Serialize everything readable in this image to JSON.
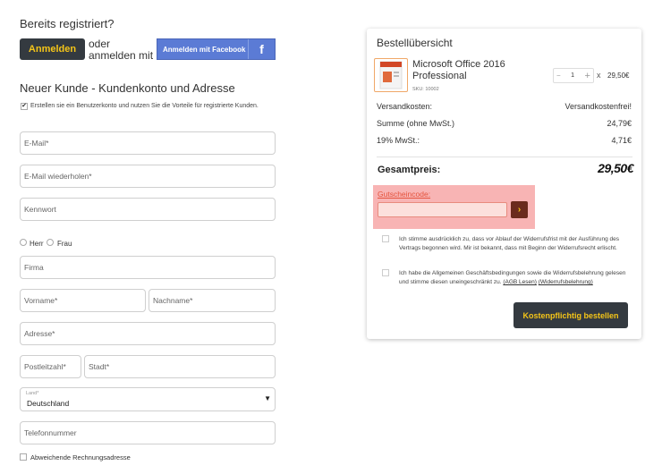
{
  "login": {
    "heading": "Bereits registriert?",
    "login_button": "Anmelden",
    "or_line1": "oder",
    "or_line2": "anmelden mit",
    "facebook_button": "Anmelden mit Facebook",
    "facebook_icon": "f"
  },
  "register": {
    "heading": "Neuer Kunde - Kundenkonto und Adresse",
    "create_account_checked": true,
    "create_account_text": "Erstellen sie ein Benutzerkonto und nutzen Sie die Vorteile für registrierte Kunden.",
    "email_placeholder": "E-Mail*",
    "email_repeat_placeholder": "E-Mail wiederholen*",
    "password_placeholder": "Kennwort",
    "salutation_mr": "Herr",
    "salutation_mrs": "Frau",
    "company_placeholder": "Firma",
    "firstname_placeholder": "Vorname*",
    "lastname_placeholder": "Nachname*",
    "address_placeholder": "Adresse*",
    "zip_placeholder": "Postleitzahl*",
    "city_placeholder": "Stadt*",
    "country_label": "Land*",
    "country_value": "Deutschland",
    "phone_placeholder": "Telefonnummer",
    "alt_billing_label": "Abweichende Rechnungsadresse"
  },
  "summary": {
    "title": "Bestellübersicht",
    "product": {
      "name": "Microsoft Office 2016 Professional",
      "sku": "SKU: 10002",
      "qty": "1",
      "multiply": "x",
      "price": "29,50€"
    },
    "rows": [
      {
        "label": "Versandkosten:",
        "value": "Versandkostenfrei!"
      },
      {
        "label": "Summe (ohne MwSt.)",
        "value": "24,79€"
      },
      {
        "label": "19% MwSt.:",
        "value": "4,71€"
      }
    ],
    "total_label": "Gesamtpreis:",
    "total_value": "29,50€",
    "coupon_label": "Gutscheincode:",
    "coupon_value": "",
    "coupon_button_icon": "›",
    "terms_withdrawal": "Ich stimme ausdrücklich zu, dass vor Ablauf der Widerrufsfrist mit der Ausführung des Vertrags begonnen wird. Mir ist bekannt, dass mit Beginn der Widerrufsrecht erlischt.",
    "terms_agb_text": "Ich habe die Allgemeinen Geschäftsbedingungen sowie die Widerrufsbelehrung gelesen und stimme diesen uneingeschränkt zu.",
    "agb_link": "(AGB Lesen)",
    "widerruf_link": "(Widerrufsbelehrung)",
    "order_button": "Kostenpflichtig bestellen"
  },
  "colors": {
    "dark_button": "#343a40",
    "accent_yellow": "#f5c518",
    "facebook_blue": "#5b7bd5",
    "coupon_highlight": "#f8b4b4",
    "coupon_label": "#e5533d"
  }
}
